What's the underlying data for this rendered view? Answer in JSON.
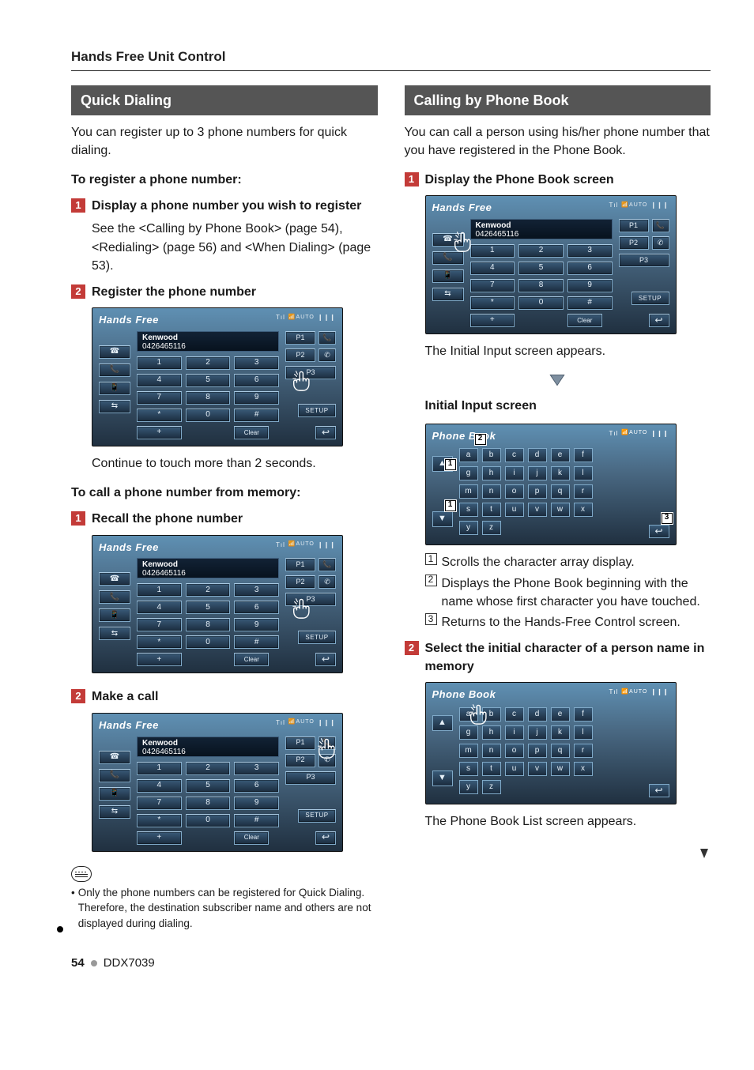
{
  "sectionTitle": "Hands Free Unit Control",
  "left": {
    "heading": "Quick Dialing",
    "intro": "You can register up to 3 phone numbers for quick dialing.",
    "registerHeading": "To register a phone number:",
    "step1": "Display a phone number you wish to register",
    "step1Body": "See the <Calling by Phone Book> (page 54), <Redialing> (page 56) and <When Dialing> (page 53).",
    "step2": "Register the phone number",
    "continueNote": "Continue to touch more than 2 seconds.",
    "callHeading": "To call a phone number from memory:",
    "recall": "Recall the phone number",
    "makeCall": "Make a call",
    "noteText": "Only the phone numbers can be registered for Quick Dialing. Therefore, the destination subscriber name and others are not displayed during dialing."
  },
  "right": {
    "heading": "Calling by Phone Book",
    "intro": "You can call a person using his/her phone number that you have registered in the Phone Book.",
    "step1": "Display the Phone Book screen",
    "initialAppears": "The Initial Input screen appears.",
    "initialHeading": "Initial Input screen",
    "legend1": "Scrolls the character array display.",
    "legend2": "Displays the Phone Book beginning with the name whose first character you have touched.",
    "legend3": "Returns to the Hands-Free Control screen.",
    "step2": "Select the initial character of a person name in memory",
    "listAppears": "The Phone Book List screen appears."
  },
  "mock": {
    "title": "Hands Free",
    "pbTitle": "Phone Book",
    "dispL1": "Kenwood",
    "dispL2": "0426465116",
    "status": {
      "a": "Tıl",
      "b": "AUTO",
      "c": "❙❙❙"
    },
    "sideIcons": [
      "☎",
      "📞",
      "📱",
      "⇆"
    ],
    "keypad": [
      "1",
      "2",
      "3",
      "4",
      "5",
      "6",
      "7",
      "8",
      "9",
      "*",
      "0",
      "#",
      "+"
    ],
    "presets": [
      "P1",
      "P2",
      "P3"
    ],
    "callIcons": [
      "📞",
      "✆"
    ],
    "setup": "SETUP",
    "clear": "Clear",
    "returnGlyph": "↩",
    "arrows": {
      "up": "▲",
      "down": "▼"
    },
    "letters": [
      "a",
      "b",
      "c",
      "d",
      "e",
      "f",
      "g",
      "h",
      "i",
      "j",
      "k",
      "l",
      "m",
      "n",
      "o",
      "p",
      "q",
      "r",
      "s",
      "t",
      "u",
      "v",
      "w",
      "x",
      "y",
      "z"
    ]
  },
  "footer": {
    "page": "54",
    "model": "DDX7039"
  }
}
